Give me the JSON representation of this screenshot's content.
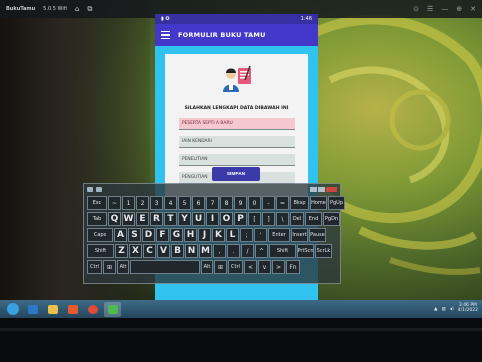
{
  "window": {
    "app_name": "BukuTamu",
    "subtitle": "5.0.5 Wifi",
    "right_controls": [
      "⊙",
      "☰",
      "—",
      "⊕",
      "✕"
    ]
  },
  "phone": {
    "status": {
      "left": "▮ ✪",
      "right": "1:46"
    },
    "app_title": "FORMULIR BUKU TAMU",
    "instruction": "SILAHKAN LENGKAPI DATA DIBAWAH INI",
    "fields": [
      {
        "placeholder": "PESERTA SEPTI A BARU"
      },
      {
        "placeholder": "IAIN KENDARI"
      },
      {
        "placeholder": "PENELITIAN"
      },
      {
        "placeholder": "PENGUTIAN"
      }
    ],
    "save_label": "SIMPAN"
  },
  "keyboard": {
    "rows": [
      [
        "Esc",
        "~",
        "1",
        "2",
        "3",
        "4",
        "5",
        "6",
        "7",
        "8",
        "9",
        "0",
        "-",
        "=",
        "Bksp",
        "Home",
        "PgUp"
      ],
      [
        "Tab",
        "Q",
        "W",
        "E",
        "R",
        "T",
        "Y",
        "U",
        "I",
        "O",
        "P",
        "[",
        "]",
        "\\",
        "Del",
        "End",
        "PgDn"
      ],
      [
        "Caps",
        "A",
        "S",
        "D",
        "F",
        "G",
        "H",
        "J",
        "K",
        "L",
        ";",
        "'",
        "Enter",
        "Insert",
        "Pause"
      ],
      [
        "Shift",
        "Z",
        "X",
        "C",
        "V",
        "B",
        "N",
        "M",
        ",",
        ".",
        "/",
        "^",
        "Shift",
        "PrtScn",
        "ScrLk"
      ],
      [
        "Ctrl",
        "⊞",
        "Alt",
        " ",
        "Alt",
        "⊞",
        "Ctrl",
        "<",
        "v",
        ">",
        "Fn"
      ]
    ]
  },
  "taskbar": {
    "apps": [
      {
        "name": "start-orb",
        "color": "#3aa0e0"
      },
      {
        "name": "internet-explorer",
        "color": "#2b78c9"
      },
      {
        "name": "file-explorer",
        "color": "#e8c04a"
      },
      {
        "name": "media",
        "color": "#e85a2c"
      },
      {
        "name": "chrome",
        "color": "#e14b35"
      },
      {
        "name": "app-green",
        "color": "#4dbb4d"
      }
    ],
    "clock_time": "3:46 PM",
    "clock_date": "4/1/2022"
  },
  "colors": {
    "app_bar": "#4338ca",
    "phone_bg": "#31c3ef",
    "save_button": "#3a3aa8"
  }
}
